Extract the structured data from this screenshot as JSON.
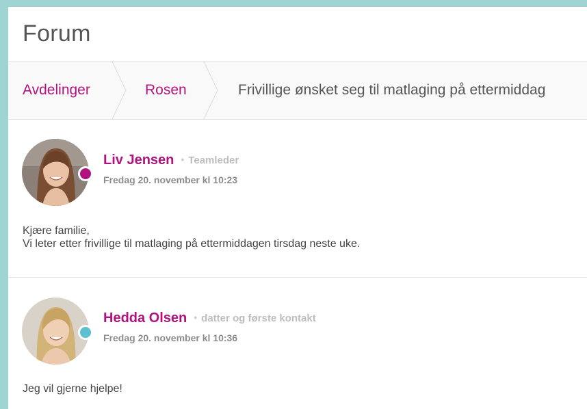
{
  "forum": {
    "title": "Forum"
  },
  "breadcrumb": {
    "items": [
      {
        "label": "Avdelinger"
      },
      {
        "label": "Rosen"
      },
      {
        "label": "Frivillige ønsket seg til matlaging på ettermiddag"
      }
    ]
  },
  "posts": [
    {
      "author": "Liv Jensen",
      "separator": "•",
      "role": "Teamleder",
      "date": "Fredag 20. november kl 10:23",
      "body": "Kjære familie,\nVi leter etter frivillige til matlaging på ettermiddagen tirsdag neste uke.",
      "status_color": "#b0137e"
    },
    {
      "author": "Hedda Olsen",
      "separator": "•",
      "role": "datter og første kontakt",
      "date": "Fredag 20. november kl 10:36",
      "body": "Jeg vil gjerne hjelpe!",
      "status_color": "#5bc0cf"
    }
  ],
  "colors": {
    "accent": "#b0137e",
    "background": "#9fd3d2"
  }
}
